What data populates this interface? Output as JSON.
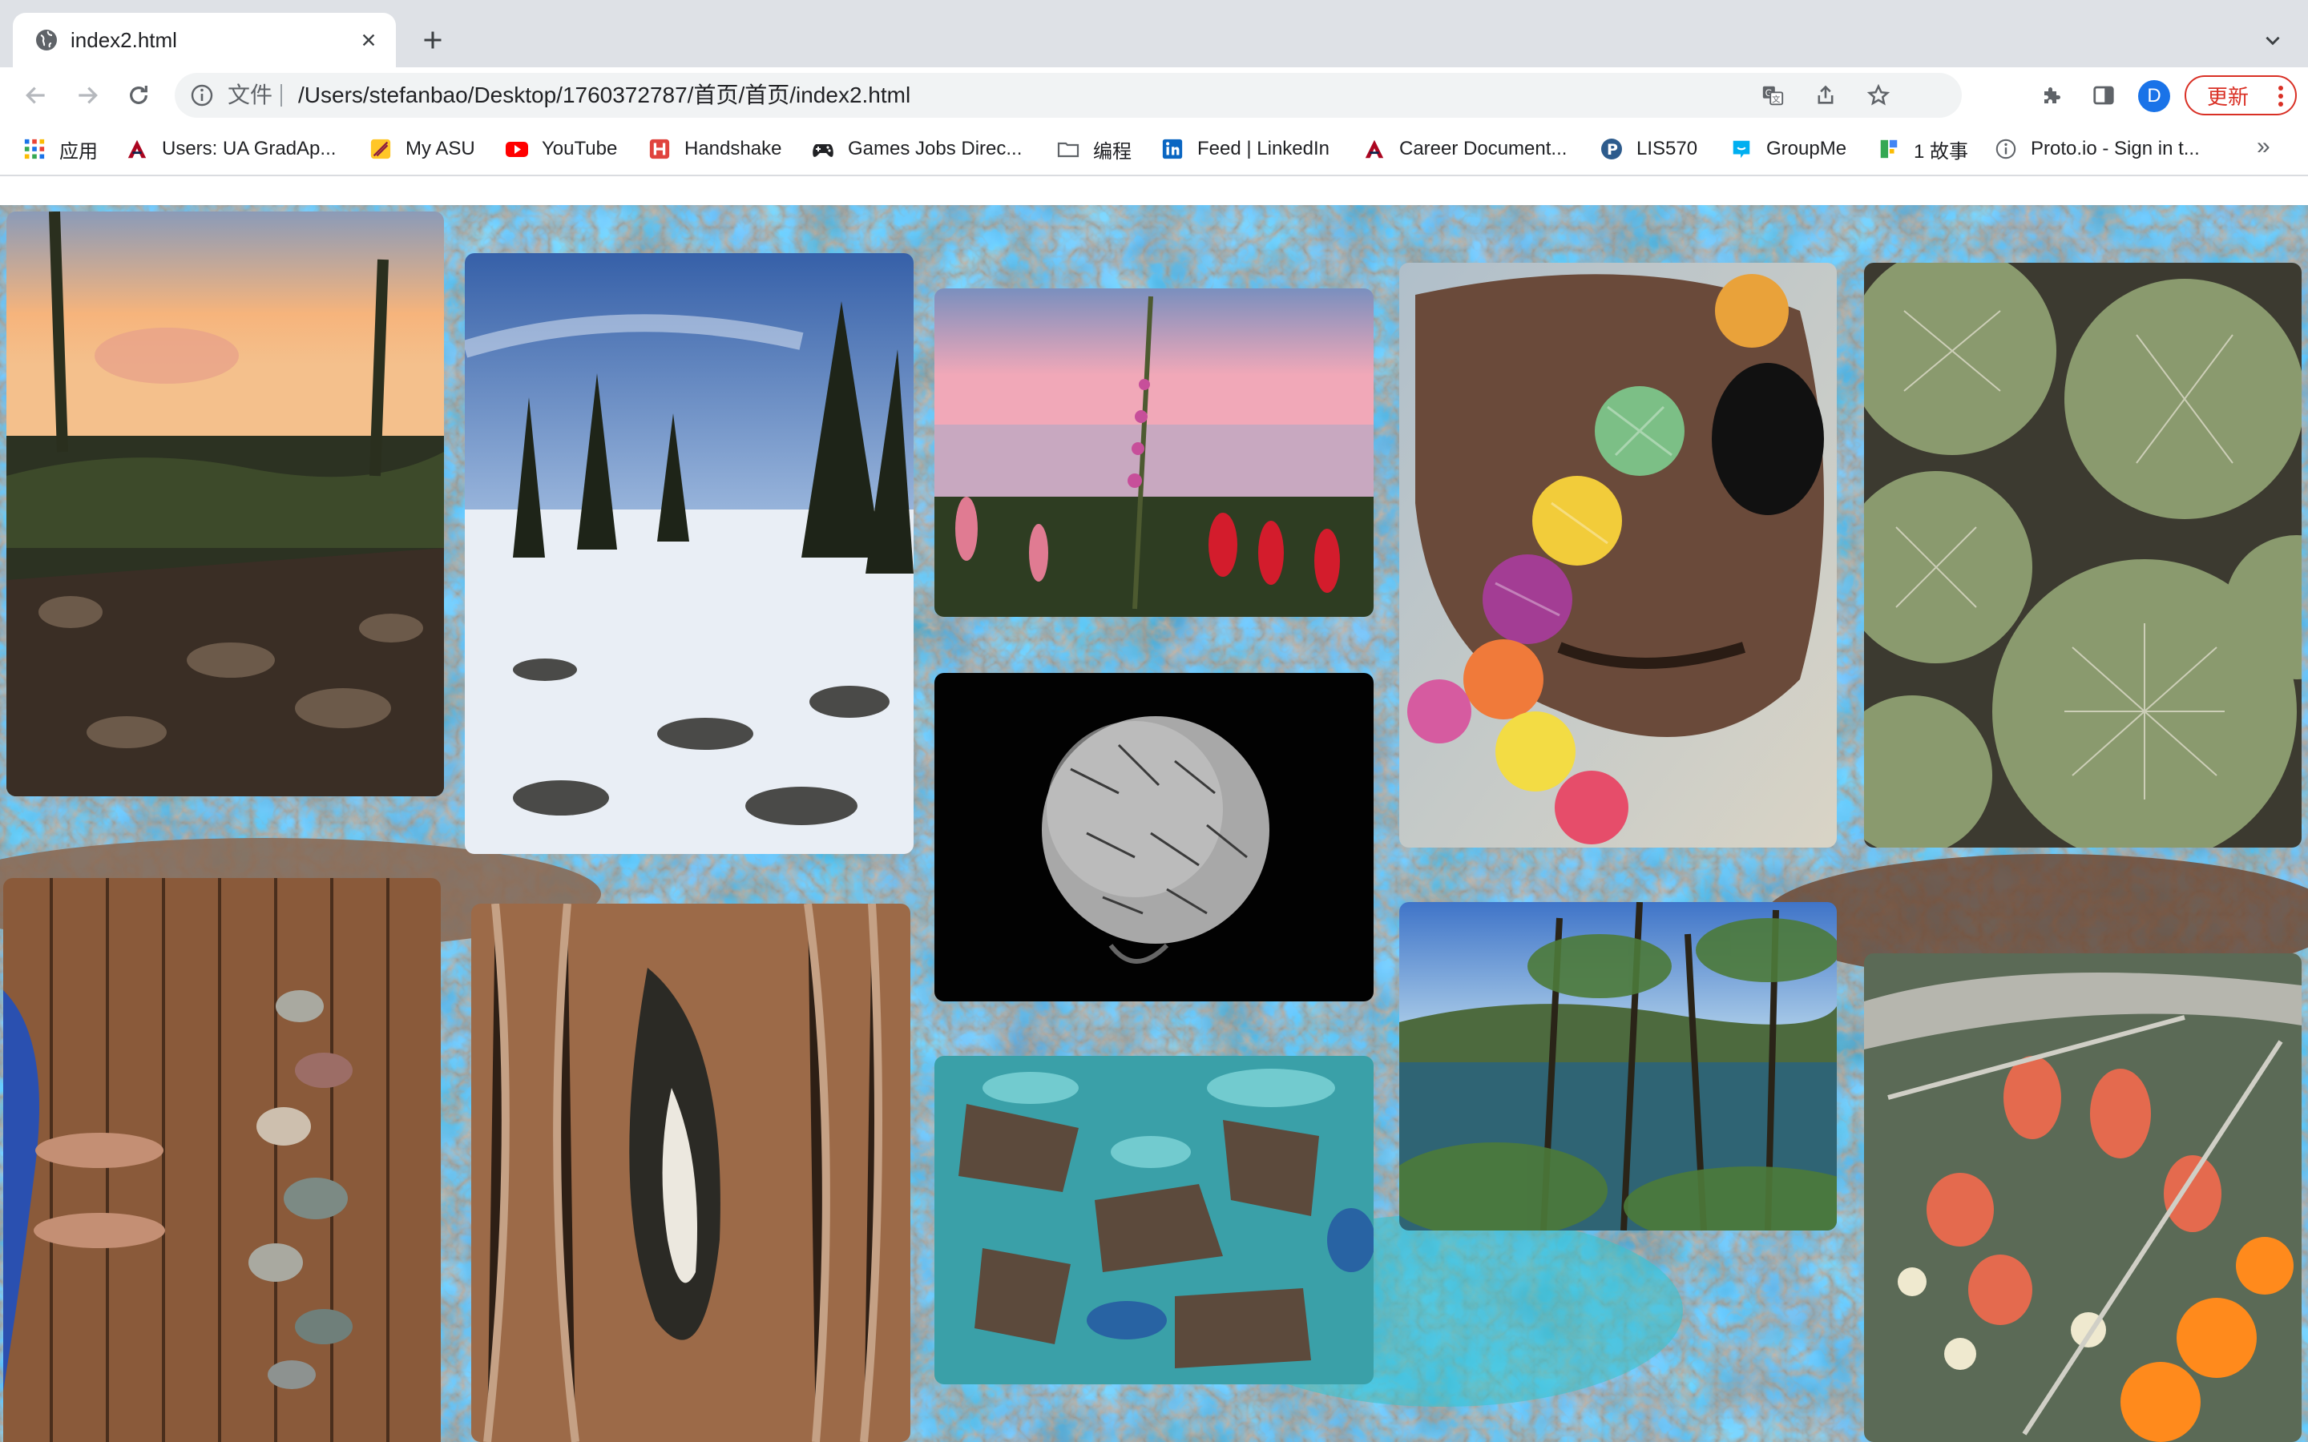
{
  "tab": {
    "title": "index2.html",
    "favicon": "globe-icon"
  },
  "toolbar": {
    "scheme_label": "文件",
    "url": "/Users/stefanbao/Desktop/1760372787/首页/首页/index2.html",
    "profile_initial": "D",
    "update_label": "更新"
  },
  "bookmarks": [
    {
      "label": "应用",
      "icon": "apps-grid-icon"
    },
    {
      "label": "Users: UA GradAp...",
      "icon": "ua-logo-icon"
    },
    {
      "label": "My ASU",
      "icon": "asu-logo-icon"
    },
    {
      "label": "YouTube",
      "icon": "youtube-icon"
    },
    {
      "label": "Handshake",
      "icon": "handshake-icon"
    },
    {
      "label": "Games Jobs Direc...",
      "icon": "gamepad-icon"
    },
    {
      "label": "编程",
      "icon": "folder-icon"
    },
    {
      "label": "Feed | LinkedIn",
      "icon": "linkedin-icon"
    },
    {
      "label": "Career Document...",
      "icon": "ua-logo-icon"
    },
    {
      "label": "LIS570",
      "icon": "p-logo-icon"
    },
    {
      "label": "GroupMe",
      "icon": "groupme-icon"
    },
    {
      "label": "1 故事",
      "icon": "story-icon"
    },
    {
      "label": "Proto.io - Sign in t...",
      "icon": "protoio-icon"
    }
  ],
  "gallery": {
    "photos": [
      "sunset-river-photo",
      "snowy-forest-photo",
      "lake-flowers-photo",
      "woven-beads-skull-photo",
      "cactus-cluster-photo",
      "cactus-bw-photo",
      "feet-pebbles-deck-photo",
      "tree-bark-photo",
      "turquoise-rock-photo",
      "forest-bay-photo",
      "flowering-cactus-photo"
    ]
  }
}
